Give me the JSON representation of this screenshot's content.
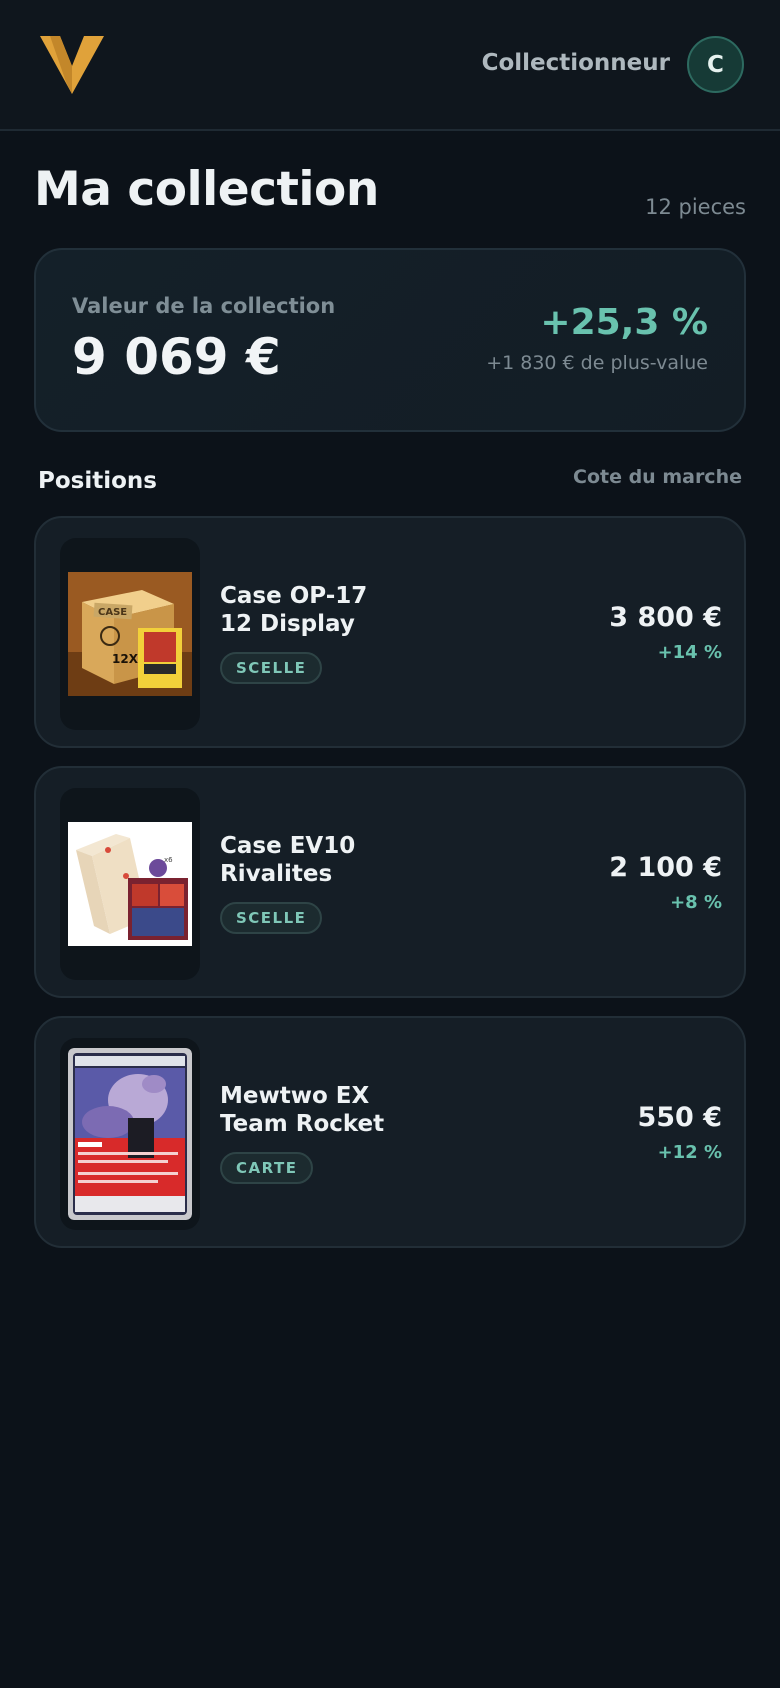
{
  "header": {
    "logo": "v-logo-icon",
    "user_label": "Collectionneur",
    "avatar_initial": "C"
  },
  "page": {
    "title": "Ma collection",
    "count": "12 pieces"
  },
  "summary": {
    "label": "Valeur de la collection",
    "value": "9 069 €",
    "performance": "+25,3 %",
    "gain": "+1 830 € de plus-value"
  },
  "positions": {
    "title": "Positions",
    "note": "Cote du marche",
    "items": [
      {
        "name_line1": "Case OP-17",
        "name_line2": "12 Display",
        "badge": "SCELLE",
        "price": "3 800 €",
        "change": "+14 %"
      },
      {
        "name_line1": "Case EV10",
        "name_line2": "Rivalites",
        "badge": "SCELLE",
        "price": "2 100 €",
        "change": "+8 %"
      },
      {
        "name_line1": "Mewtwo EX",
        "name_line2": "Team Rocket",
        "badge": "CARTE",
        "price": "550 €",
        "change": "+12 %"
      }
    ]
  },
  "colors": {
    "background": "#0c1219",
    "accent_gold": "#e0a23a",
    "positive": "#69c2ae"
  }
}
